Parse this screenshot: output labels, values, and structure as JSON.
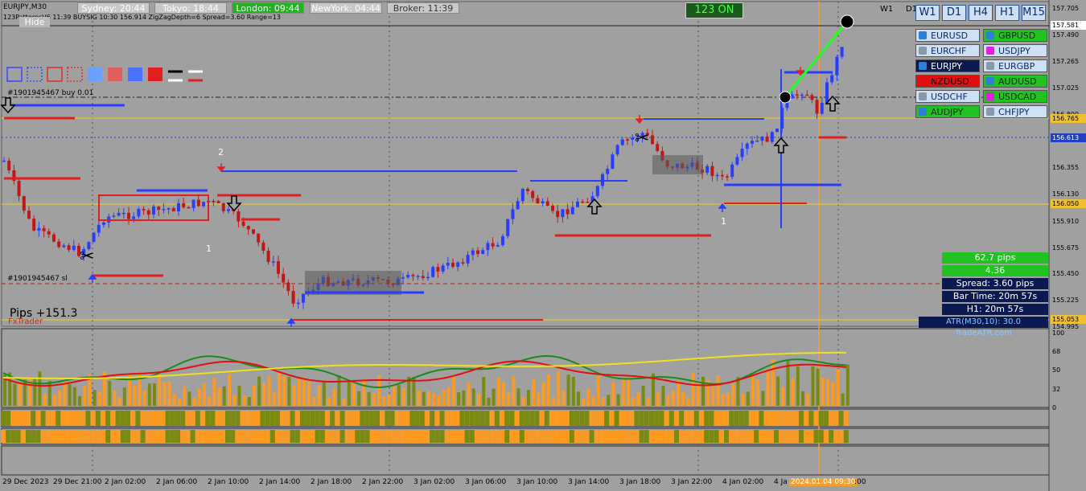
{
  "window": {
    "symbol_label": "EURJPY,M30",
    "indicator_line": "123PatternsV6   11:39   BUYSIG   10:30   156.914   ZigZagDepth=6   Spread=3.60   Range=13",
    "hide_label": "Hide"
  },
  "sessions": [
    {
      "label": "Sydney: 20:44",
      "bg": "#c8c8c8",
      "fg": "#ffffff"
    },
    {
      "label": "Tokyo: 18:44",
      "bg": "#c8c8c8",
      "fg": "#ffffff"
    },
    {
      "label": "London: 09:44",
      "bg": "#22b222",
      "fg": "#ffffff"
    },
    {
      "label": "NewYork: 04:44",
      "bg": "#c8c8c8",
      "fg": "#ffffff"
    },
    {
      "label": "Broker: 11:39",
      "bg": "#c8c8c8",
      "fg": "#333333"
    }
  ],
  "pattern_badge": "123 ON",
  "period_markers": [
    "W1",
    "D1"
  ],
  "timeframes": [
    "W1",
    "D1",
    "H4",
    "H1",
    "M15"
  ],
  "symbols": [
    {
      "label": "EURUSD",
      "bg": "#cfe0f5",
      "fg": "#0a2a6a",
      "dot": "#2d7fd8"
    },
    {
      "label": "GBPUSD",
      "bg": "#22c222",
      "fg": "#0a2a0a",
      "dot": "#2d7fd8"
    },
    {
      "label": "EURCHF",
      "bg": "#cfe0f5",
      "fg": "#0a2a6a",
      "dot": "#8899aa"
    },
    {
      "label": "USDJPY",
      "bg": "#cfe0f5",
      "fg": "#0a2a6a",
      "dot": "#e020e0"
    },
    {
      "label": "EURJPY",
      "bg": "#0a1a50",
      "fg": "#ffffff",
      "dot": "#2d7fd8"
    },
    {
      "label": "EURGBP",
      "bg": "#cfe0f5",
      "fg": "#0a2a6a",
      "dot": "#8899aa"
    },
    {
      "label": "NZDUSD",
      "bg": "#e01010",
      "fg": "#0a0a0a",
      "dot": "#e01010"
    },
    {
      "label": "AUDUSD",
      "bg": "#22c222",
      "fg": "#0a2a0a",
      "dot": "#2d7fd8"
    },
    {
      "label": "USDCHF",
      "bg": "#cfe0f5",
      "fg": "#0a2a6a",
      "dot": "#8899aa"
    },
    {
      "label": "USDCAD",
      "bg": "#22c222",
      "fg": "#0a2a0a",
      "dot": "#e020e0"
    },
    {
      "label": "AUDJPY",
      "bg": "#22c222",
      "fg": "#0a2a0a",
      "dot": "#2d7fd8"
    },
    {
      "label": "CHFJPY",
      "bg": "#cfe0f5",
      "fg": "#0a2a6a",
      "dot": "#8899aa"
    }
  ],
  "price_axis": [
    {
      "label": "157.705",
      "type": "tick"
    },
    {
      "label": "157.581",
      "type": "current",
      "bg": "#ffffff",
      "fg": "#000000"
    },
    {
      "label": "157.490",
      "type": "tick"
    },
    {
      "label": "157.265",
      "type": "tick"
    },
    {
      "label": "157.025",
      "type": "tick"
    },
    {
      "label": "156.800",
      "type": "tick"
    },
    {
      "label": "156.765",
      "type": "level",
      "bg": "#f0c030",
      "fg": "#000000"
    },
    {
      "label": "156.613",
      "type": "level",
      "bg": "#2040c0",
      "fg": "#ffffff"
    },
    {
      "label": "156.355",
      "type": "tick"
    },
    {
      "label": "156.130",
      "type": "tick"
    },
    {
      "label": "156.050",
      "type": "level",
      "bg": "#f0c030",
      "fg": "#000000"
    },
    {
      "label": "155.910",
      "type": "tick"
    },
    {
      "label": "155.675",
      "type": "tick"
    },
    {
      "label": "155.450",
      "type": "tick"
    },
    {
      "label": "155.225",
      "type": "tick"
    },
    {
      "label": "155.053",
      "type": "level",
      "bg": "#f0c030",
      "fg": "#000000"
    },
    {
      "label": "154.995",
      "type": "tick"
    }
  ],
  "osc_axis": [
    "100",
    "68",
    "50",
    "32",
    "0"
  ],
  "time_axis": [
    "29 Dec 2023",
    "29 Dec 21:00",
    "2 Jan 02:00",
    "2 Jan 06:00",
    "2 Jan 10:00",
    "2 Jan 14:00",
    "2 Jan 18:00",
    "2 Jan 22:00",
    "3 Jan 02:00",
    "3 Jan 06:00",
    "3 Jan 10:00",
    "3 Jan 14:00",
    "3 Jan 18:00",
    "3 Jan 22:00",
    "4 Jan 02:00",
    "4 Ja",
    "2024.01.04 09:30",
    ":00"
  ],
  "annotations": {
    "buy_order": "#1901945467 buy 0.01",
    "sl_order": "#1901945467 sl",
    "pips_total": "Pips +151.3",
    "brand": "FxTrader",
    "wave_1a": "1",
    "wave_2": "2",
    "wave_1b": "1"
  },
  "info_panel": {
    "pips": "62.7 pips",
    "ratio": "4.36",
    "spread": "Spread: 3.60 pips",
    "bar_time": "Bar Time: 20m 57s",
    "h1": "H1: 20m 57s",
    "atr": "ATR(M30,10): 30.0 TradeATR.com"
  },
  "colors": {
    "background": "#a0a0a0",
    "bull": "#2a3cff",
    "bear": "#c01818",
    "level_yellow": "#f0d020",
    "volume_orange": "#ff9a20",
    "volume_olive": "#7a8a10"
  }
}
